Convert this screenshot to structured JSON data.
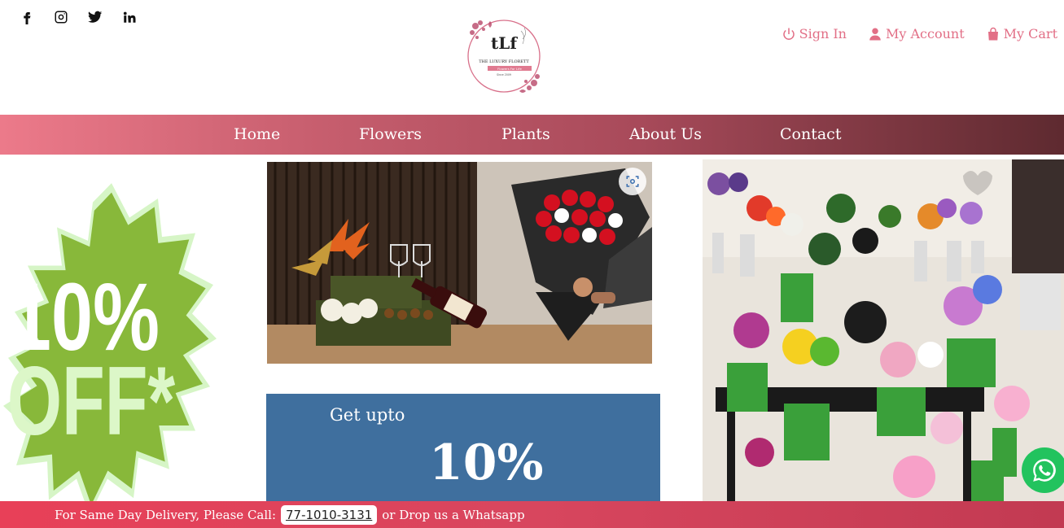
{
  "header": {
    "social": [
      {
        "name": "facebook-icon"
      },
      {
        "name": "instagram-icon"
      },
      {
        "name": "twitter-icon"
      },
      {
        "name": "linkedin-icon"
      }
    ],
    "logo": {
      "monogram": "tLf",
      "brand": "THE LUXURY FLORETT",
      "tagline": "Flowers For Life",
      "since": "Since 2009"
    },
    "account": {
      "sign_in": "Sign In",
      "my_account": "My Account",
      "my_cart": "My Cart"
    }
  },
  "nav": {
    "items": [
      "Home",
      "Flowers",
      "Plants",
      "About Us",
      "Contact"
    ]
  },
  "promo": {
    "sticker_text": "10% OFF*",
    "box_upto": "Get upto",
    "box_percent": "10%"
  },
  "bottom_bar": {
    "prefix": "For Same Day Delivery, Please Call:",
    "phone": "77-1010-3131",
    "suffix": "or Drop us a Whatsapp"
  },
  "colors": {
    "accent_pink": "#e26f86",
    "promo_blue": "#3f6f9e",
    "bottom_bar": "#e84058",
    "whatsapp_green": "#22c35e"
  }
}
